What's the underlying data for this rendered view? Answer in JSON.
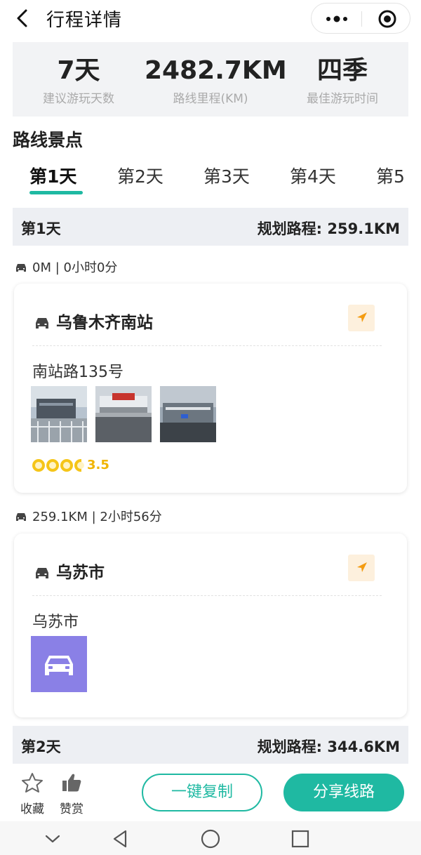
{
  "header": {
    "title": "行程详情"
  },
  "stats": [
    {
      "value": "7天",
      "label": "建议游玩天数"
    },
    {
      "value": "2482.7KM",
      "label": "路线里程(KM)"
    },
    {
      "value": "四季",
      "label": "最佳游玩时间"
    }
  ],
  "section_title": "路线景点",
  "tabs": [
    "第1天",
    "第2天",
    "第3天",
    "第4天",
    "第5"
  ],
  "active_tab": 0,
  "days": [
    {
      "name": "第1天",
      "distance": "规划路程: 259.1KM"
    },
    {
      "name": "第2天",
      "distance": "规划路程: 344.6KM"
    }
  ],
  "stops": [
    {
      "route_info": "0M | 0小时0分",
      "title": "乌鲁木齐南站",
      "address": "南站路135号",
      "rating": "3.5",
      "rating_value": 3.5,
      "photos": [
        "station-photo-1",
        "station-photo-2",
        "station-photo-3"
      ]
    },
    {
      "route_info": "259.1KM | 2小时56分",
      "title": "乌苏市",
      "address": "乌苏市",
      "placeholder_icon": "car-icon"
    }
  ],
  "bottom": {
    "favorite_label": "收藏",
    "like_label": "赞赏",
    "copy_label": "一键复制",
    "share_label": "分享线路"
  },
  "colors": {
    "accent": "#1fb9a2",
    "rating": "#f5c518",
    "nav_button_bg": "#fdf0dd",
    "nav_arrow": "#f39c12",
    "placeholder_bg": "#8a80e6"
  }
}
